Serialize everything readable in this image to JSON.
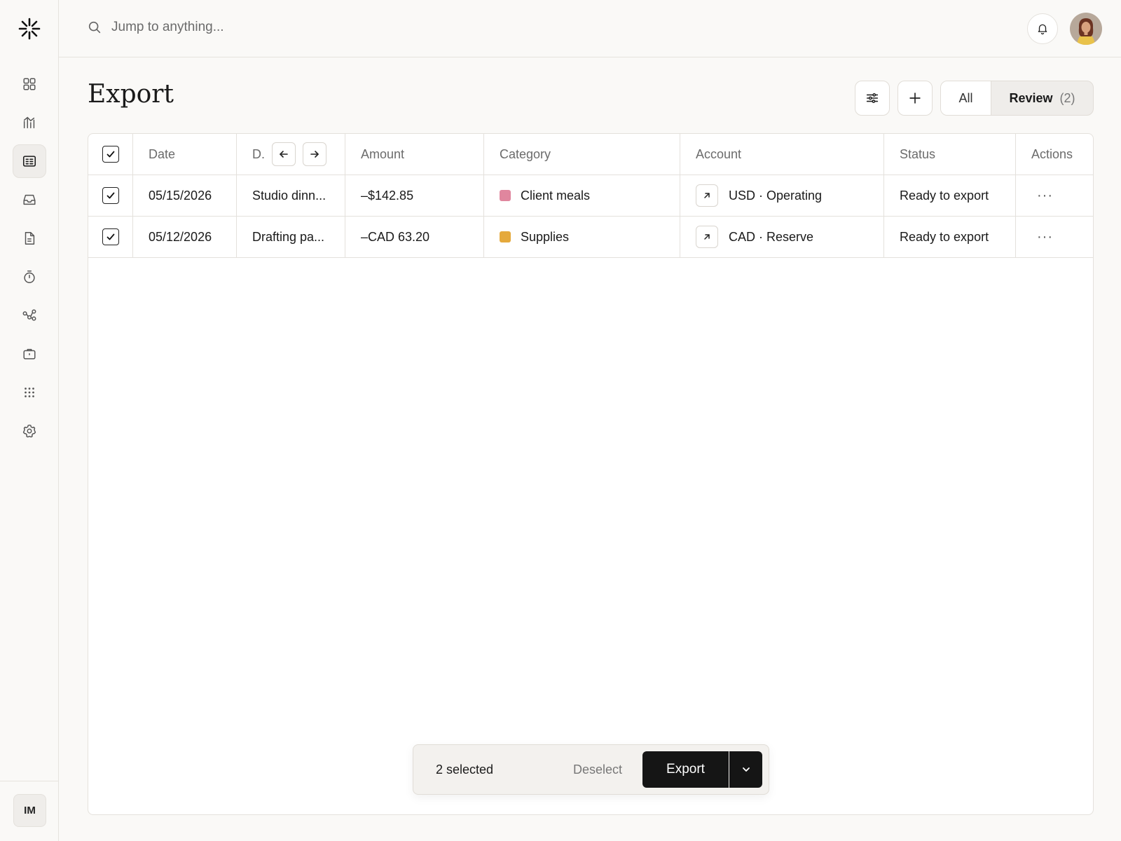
{
  "search": {
    "placeholder": "Jump to anything..."
  },
  "sidebar": {
    "items": [
      {
        "icon": "dashboard-icon",
        "active": false
      },
      {
        "icon": "chart-icon",
        "active": false
      },
      {
        "icon": "transactions-icon",
        "active": true
      },
      {
        "icon": "inbox-icon",
        "active": false
      },
      {
        "icon": "document-icon",
        "active": false
      },
      {
        "icon": "timer-icon",
        "active": false
      },
      {
        "icon": "workflow-icon",
        "active": false
      },
      {
        "icon": "briefcase-icon",
        "active": false
      },
      {
        "icon": "apps-grid-icon",
        "active": false
      },
      {
        "icon": "settings-icon",
        "active": false
      }
    ],
    "user_initials": "IM"
  },
  "page": {
    "title": "Export",
    "segment": {
      "all_label": "All",
      "review_label": "Review",
      "review_count": "(2)"
    }
  },
  "table": {
    "headers": {
      "date": "Date",
      "description": "D.",
      "amount": "Amount",
      "category": "Category",
      "account": "Account",
      "status": "Status",
      "actions": "Actions"
    },
    "rows": [
      {
        "checked": true,
        "date": "05/15/2026",
        "description": "Studio dinn...",
        "amount": "–$142.85",
        "category": "Client meals",
        "category_color": "#e0869e",
        "account": "USD · Operating",
        "status": "Ready to export",
        "actions": "···"
      },
      {
        "checked": true,
        "date": "05/12/2026",
        "description": "Drafting pa...",
        "amount": "–CAD 63.20",
        "category": "Supplies",
        "category_color": "#e5a93c",
        "account": "CAD · Reserve",
        "status": "Ready to export",
        "actions": "···"
      }
    ]
  },
  "actionbar": {
    "selected_text": "2 selected",
    "deselect_label": "Deselect",
    "export_label": "Export"
  }
}
